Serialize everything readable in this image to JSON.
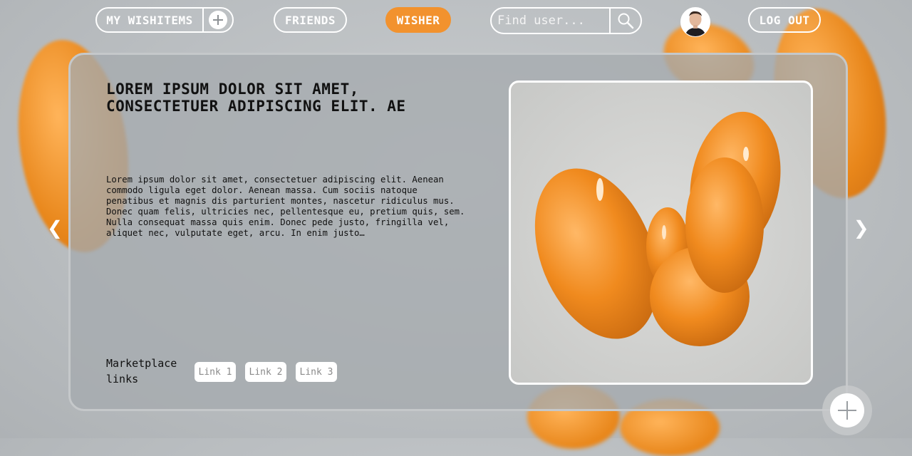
{
  "nav": {
    "my_wishitems": "MY WISHITEMS",
    "friends": "FRIENDS",
    "wisher": "WISHER",
    "search_placeholder": "Find user...",
    "logout": "LOG OUT"
  },
  "item": {
    "title": "LOREM IPSUM DOLOR SIT AMET, CONSECTETUER ADIPISCING ELIT. AE",
    "description": "Lorem ipsum dolor sit amet, consectetuer adipiscing elit. Aenean commodo ligula eget dolor. Aenean massa. Cum sociis natoque penatibus et magnis dis parturient montes, nascetur ridiculus mus. Donec quam felis, ultricies nec, pellentesque eu, pretium quis, sem. Nulla consequat massa quis enim. Donec pede justo, fringilla vel, aliquet nec, vulputate eget, arcu. In enim justo…",
    "marketplace_label": "Marketplace links",
    "links": [
      "Link 1",
      "Link 2",
      "Link 3"
    ]
  },
  "carousel": {
    "prev": "❮",
    "next": "❯"
  },
  "colors": {
    "accent": "#f2922e",
    "blob": "#e8861a",
    "frame": "#ffffff"
  },
  "icons": [
    "plus-circle-icon",
    "search-icon",
    "user-avatar-icon",
    "chevron-left-icon",
    "chevron-right-icon",
    "add-icon"
  ]
}
